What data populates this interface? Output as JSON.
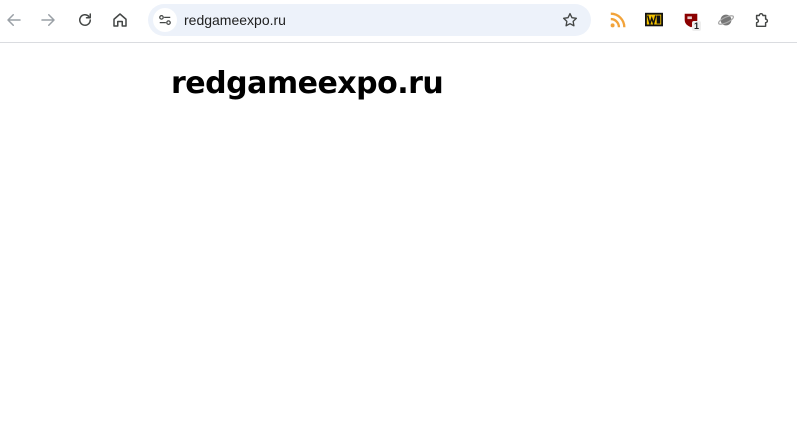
{
  "browser": {
    "address_bar": {
      "url": "redgameexpo.ru"
    },
    "nav_icons": [
      "arrow-left-icon",
      "arrow-right-icon",
      "reload-icon",
      "home-icon"
    ],
    "extensions": [
      {
        "icon": "rss-icon",
        "color": "#f2a33a"
      },
      {
        "icon": "w-logo-icon",
        "color": "#f5c400"
      },
      {
        "icon": "shield-icon",
        "color": "#8b0000",
        "badge": "1"
      },
      {
        "icon": "planet-icon",
        "color": "#777777"
      },
      {
        "icon": "puzzle-icon",
        "color": "#444746"
      }
    ]
  },
  "page": {
    "heading": "redgameexpo.ru"
  }
}
